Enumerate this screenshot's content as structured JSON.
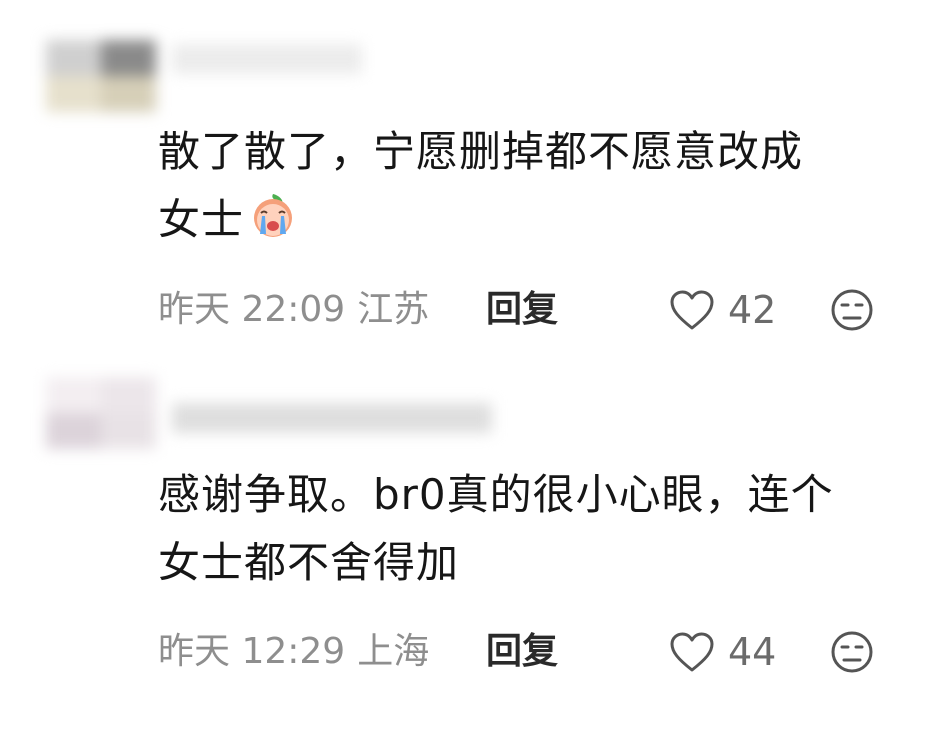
{
  "comments": [
    {
      "text_line1": "散了散了，宁愿删掉都不愿意改成",
      "text_line2": "女士",
      "emoji": "crying-peach-emoji",
      "time": "昨天 22:09",
      "location": "江苏",
      "reply_label": "回复",
      "likes": "42"
    },
    {
      "text_line1": "感谢争取。br0真的很小心眼，连个",
      "text_line2": "女士都不舍得加",
      "time": "昨天 12:29",
      "location": "上海",
      "reply_label": "回复",
      "likes": "44"
    }
  ],
  "icons": {
    "like": "heart-outline-icon",
    "dislike": "unhappy-face-icon"
  },
  "colors": {
    "text": "#161616",
    "meta": "#8e8e8e",
    "reply": "#2a2a2a",
    "like_count": "#6b6b6b",
    "icon": "#555555"
  }
}
